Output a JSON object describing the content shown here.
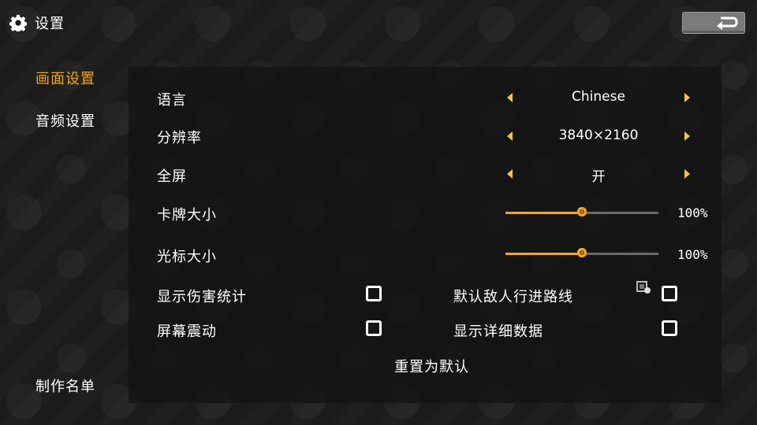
{
  "header": {
    "title": "设置",
    "icon": "gear-icon"
  },
  "back_button": {
    "icon": "return-arrow-icon"
  },
  "nav": {
    "items": [
      {
        "label": "画面设置",
        "active": true
      },
      {
        "label": "音频设置",
        "active": false
      }
    ],
    "credits": "制作名单"
  },
  "accent_color": "#f5a623",
  "settings": {
    "language": {
      "label": "语言",
      "value": "Chinese"
    },
    "resolution": {
      "label": "分辨率",
      "value": "3840×2160"
    },
    "fullscreen": {
      "label": "全屏",
      "value": "开"
    },
    "card_size": {
      "label": "卡牌大小",
      "value_text": "100%",
      "level": 0.5
    },
    "cursor_size": {
      "label": "光标大小",
      "value_text": "100%",
      "level": 0.5
    },
    "show_damage_stats": {
      "label": "显示伤害统计",
      "checked": false
    },
    "screen_shake": {
      "label": "屏幕震动",
      "checked": false
    },
    "default_enemy_path": {
      "label": "默认敌人行进路线",
      "checked": false,
      "icon": "path-preview-icon"
    },
    "show_detailed_data": {
      "label": "显示详细数据",
      "checked": false
    }
  },
  "reset_label": "重置为默认"
}
